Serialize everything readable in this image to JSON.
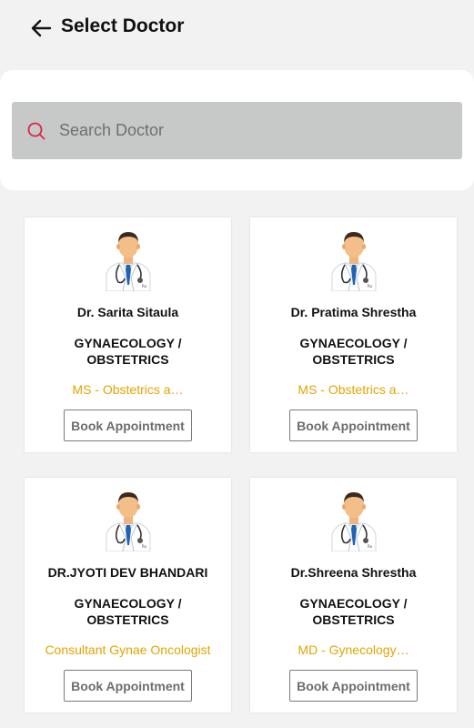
{
  "header": {
    "title": "Select Doctor",
    "back_icon": "arrow-left-icon"
  },
  "search": {
    "placeholder": "Search Doctor",
    "value": "",
    "icon": "search-icon",
    "icon_color": "#e0244a"
  },
  "colors": {
    "qualification": "#e3a400",
    "search_bg": "#c6c9c8",
    "background": "#f2f2f2"
  },
  "doctors": [
    {
      "name": "Dr. Sarita Sitaula",
      "dept_line1": "GYNAECOLOGY /",
      "dept_line2": "OBSTETRICS",
      "qualification": "MS - Obstetrics a…",
      "button": "Book Appointment"
    },
    {
      "name": "Dr. Pratima Shrestha",
      "dept_line1": "GYNAECOLOGY /",
      "dept_line2": "OBSTETRICS",
      "qualification": "MS - Obstetrics a…",
      "button": "Book Appointment"
    },
    {
      "name": "DR.JYOTI DEV BHANDARI",
      "dept_line1": "GYNAECOLOGY /",
      "dept_line2": "OBSTETRICS",
      "qualification": "Consultant Gynae Oncologist",
      "button": "Book Appointment"
    },
    {
      "name": "Dr.Shreena Shrestha",
      "dept_line1": "GYNAECOLOGY /",
      "dept_line2": "OBSTETRICS",
      "qualification": "MD - Gynecology…",
      "button": "Book Appointment"
    }
  ]
}
